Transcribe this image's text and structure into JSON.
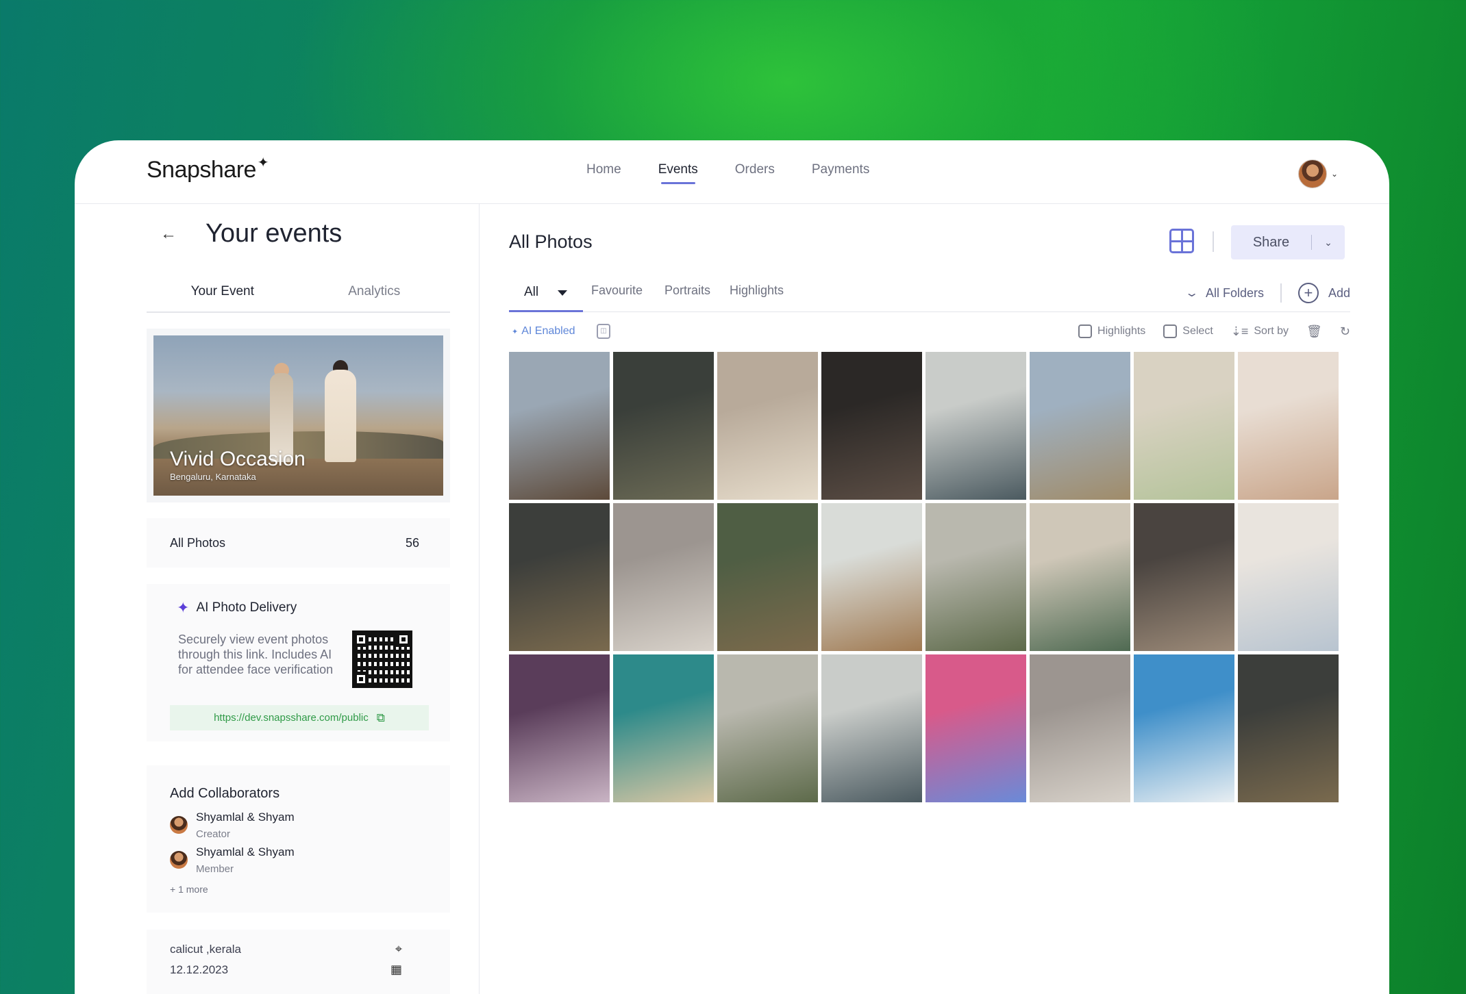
{
  "app": {
    "logo": "Snapshare",
    "nav": [
      {
        "label": "Home",
        "active": false
      },
      {
        "label": "Events",
        "active": true
      },
      {
        "label": "Orders",
        "active": false
      },
      {
        "label": "Payments",
        "active": false
      }
    ]
  },
  "sidebar": {
    "title": "Your events",
    "tabs": [
      {
        "label": "Your Event",
        "active": true
      },
      {
        "label": "Analytics",
        "active": false
      }
    ],
    "event": {
      "name": "Vivid Occasion",
      "location": "Bengaluru, Karnataka"
    },
    "all_photos": {
      "label": "All Photos",
      "count": "56"
    },
    "delivery": {
      "title": "AI Photo Delivery",
      "description": "Securely view event photos through this link. Includes AI for attendee face verification",
      "link": "https://dev.snapsshare.com/public"
    },
    "collaborators": {
      "title": "Add Collaborators",
      "people": [
        {
          "name": "Shyamlal & Shyam",
          "role": "Creator"
        },
        {
          "name": "Shyamlal & Shyam",
          "role": "Member"
        }
      ],
      "more": "+ 1 more"
    },
    "meta": {
      "location": "calicut ,kerala",
      "date": "12.12.2023"
    }
  },
  "main": {
    "title": "All Photos",
    "share_label": "Share",
    "filters": {
      "all_label": "All",
      "tabs": [
        "Favourite",
        "Portraits",
        "Highlights"
      ],
      "folders_label": "All Folders",
      "add_label": "Add"
    },
    "toolbar": {
      "ai_label": "AI Enabled",
      "highlights_label": "Highlights",
      "select_label": "Select",
      "sort_label": "Sort by"
    },
    "photos": [
      {
        "name": "photo-mountain-hiker",
        "c1": "#9aa7b4",
        "c2": "#5d4a3a"
      },
      {
        "name": "photo-escalator-man",
        "c1": "#3a3f3a",
        "c2": "#6b6a55"
      },
      {
        "name": "photo-candles-cozy",
        "c1": "#b8aa9a",
        "c2": "#e6dccb"
      },
      {
        "name": "photo-woman-dark-dress",
        "c1": "#2b2826",
        "c2": "#5c4e45"
      },
      {
        "name": "photo-houseboat-canal",
        "c1": "#c9ccc9",
        "c2": "#4b5a60"
      },
      {
        "name": "photo-ornate-dome",
        "c1": "#9fb0c0",
        "c2": "#a08c6a"
      },
      {
        "name": "photo-woman-reading",
        "c1": "#d9d2c2",
        "c2": "#b4c39a"
      },
      {
        "name": "photo-puppy-bed",
        "c1": "#e8ddd3",
        "c2": "#c9a58a"
      },
      {
        "name": "photo-antwerpen-clock",
        "c1": "#3c3e3b",
        "c2": "#7a6a4e"
      },
      {
        "name": "photo-woman-stairs",
        "c1": "#9c9590",
        "c2": "#d8d2ca"
      },
      {
        "name": "photo-green-room-chair",
        "c1": "#4f5e44",
        "c2": "#7c6a4c"
      },
      {
        "name": "photo-pier-walk",
        "c1": "#d9dcd8",
        "c2": "#a07a52"
      },
      {
        "name": "photo-white-house-tree",
        "c1": "#b9b8ae",
        "c2": "#5d6a4a"
      },
      {
        "name": "photo-balcony-building",
        "c1": "#cfc7b8",
        "c2": "#4f6a52"
      },
      {
        "name": "photo-street-scooter",
        "c1": "#4a4440",
        "c2": "#9c8a78"
      },
      {
        "name": "photo-curly-woman",
        "c1": "#e9e4de",
        "c2": "#b8c4d0"
      },
      {
        "name": "photo-lilac-flowers",
        "c1": "#5a3d5a",
        "c2": "#c9b4c4"
      },
      {
        "name": "photo-beach-aerial",
        "c1": "#2d8a8a",
        "c2": "#d9c7a4"
      },
      {
        "name": "photo-white-house-2",
        "c1": "#b9b8ae",
        "c2": "#5d6a4a"
      },
      {
        "name": "photo-houseboat-2",
        "c1": "#c9ccc9",
        "c2": "#4b5a60"
      },
      {
        "name": "photo-graffiti-woman",
        "c1": "#d85a8a",
        "c2": "#6a8ad8"
      },
      {
        "name": "photo-woman-stairs-2",
        "c1": "#9c9590",
        "c2": "#d8d2ca"
      },
      {
        "name": "photo-palau-arts",
        "c1": "#3f8fc9",
        "c2": "#e8eef2"
      },
      {
        "name": "photo-antwerpen-clock-2",
        "c1": "#3c3e3b",
        "c2": "#7a6a4e"
      }
    ]
  },
  "colors": {
    "accent": "#6a73d8",
    "link_green": "#2f9a47",
    "ai_blue": "#5e86d8"
  }
}
